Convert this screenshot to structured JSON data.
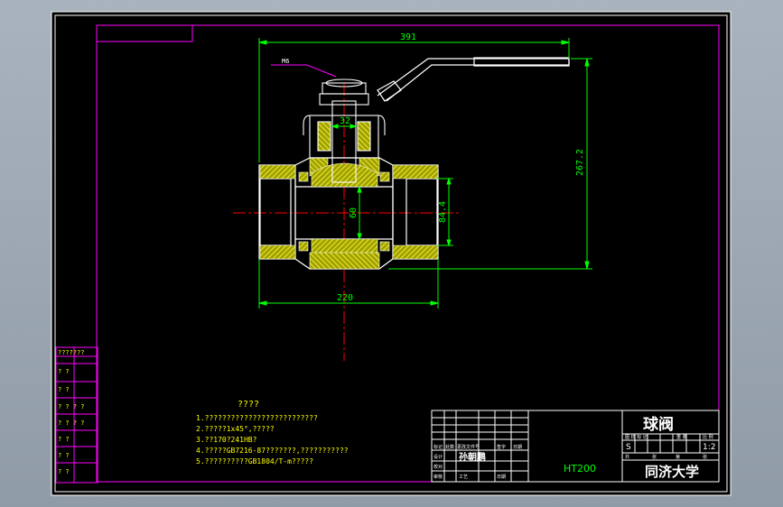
{
  "dimensions": {
    "overall_length": "391",
    "height": "267.2",
    "bore_width": "32",
    "port_diameter": "60",
    "thread_diameter": "84.4",
    "body_length": "220"
  },
  "callout": "M6",
  "notes": {
    "heading": "????",
    "items": [
      "1.??????????????????????????",
      "2.?????1x45°,?????",
      "3.??170?241HB?",
      "4.?????GB7216-87???????,???????????",
      "5.??????????GB1804/T-m?????"
    ]
  },
  "side_table": [
    "???????",
    "?     ?",
    "?     ?",
    "? ? ? ?",
    "? ? ? ?",
    "?     ?",
    "?     ?",
    "?     ?"
  ],
  "title_block": {
    "part_name": "球阀",
    "material": "HT200",
    "school": "同济大学",
    "scale": "1:2",
    "sheet_code": "S",
    "designer": "孙朝鹏",
    "header_labels": [
      "图 样 标 记",
      "重 量",
      "比 例"
    ],
    "sheet_labels": [
      "共",
      "张",
      "第",
      "张"
    ],
    "row_labels": [
      "标记",
      "处数",
      "更改文件号",
      "签字",
      "日期"
    ],
    "role_labels": [
      "设计",
      "校对",
      "审核",
      "工艺",
      "日期"
    ]
  },
  "colors": {
    "background": "#000000",
    "frame": "#ff00ff",
    "outline": "#ffffff",
    "dimension": "#00ff00",
    "centerline": "#ff0000",
    "section_fill": "#ffff00",
    "notes": "#ffff00"
  }
}
